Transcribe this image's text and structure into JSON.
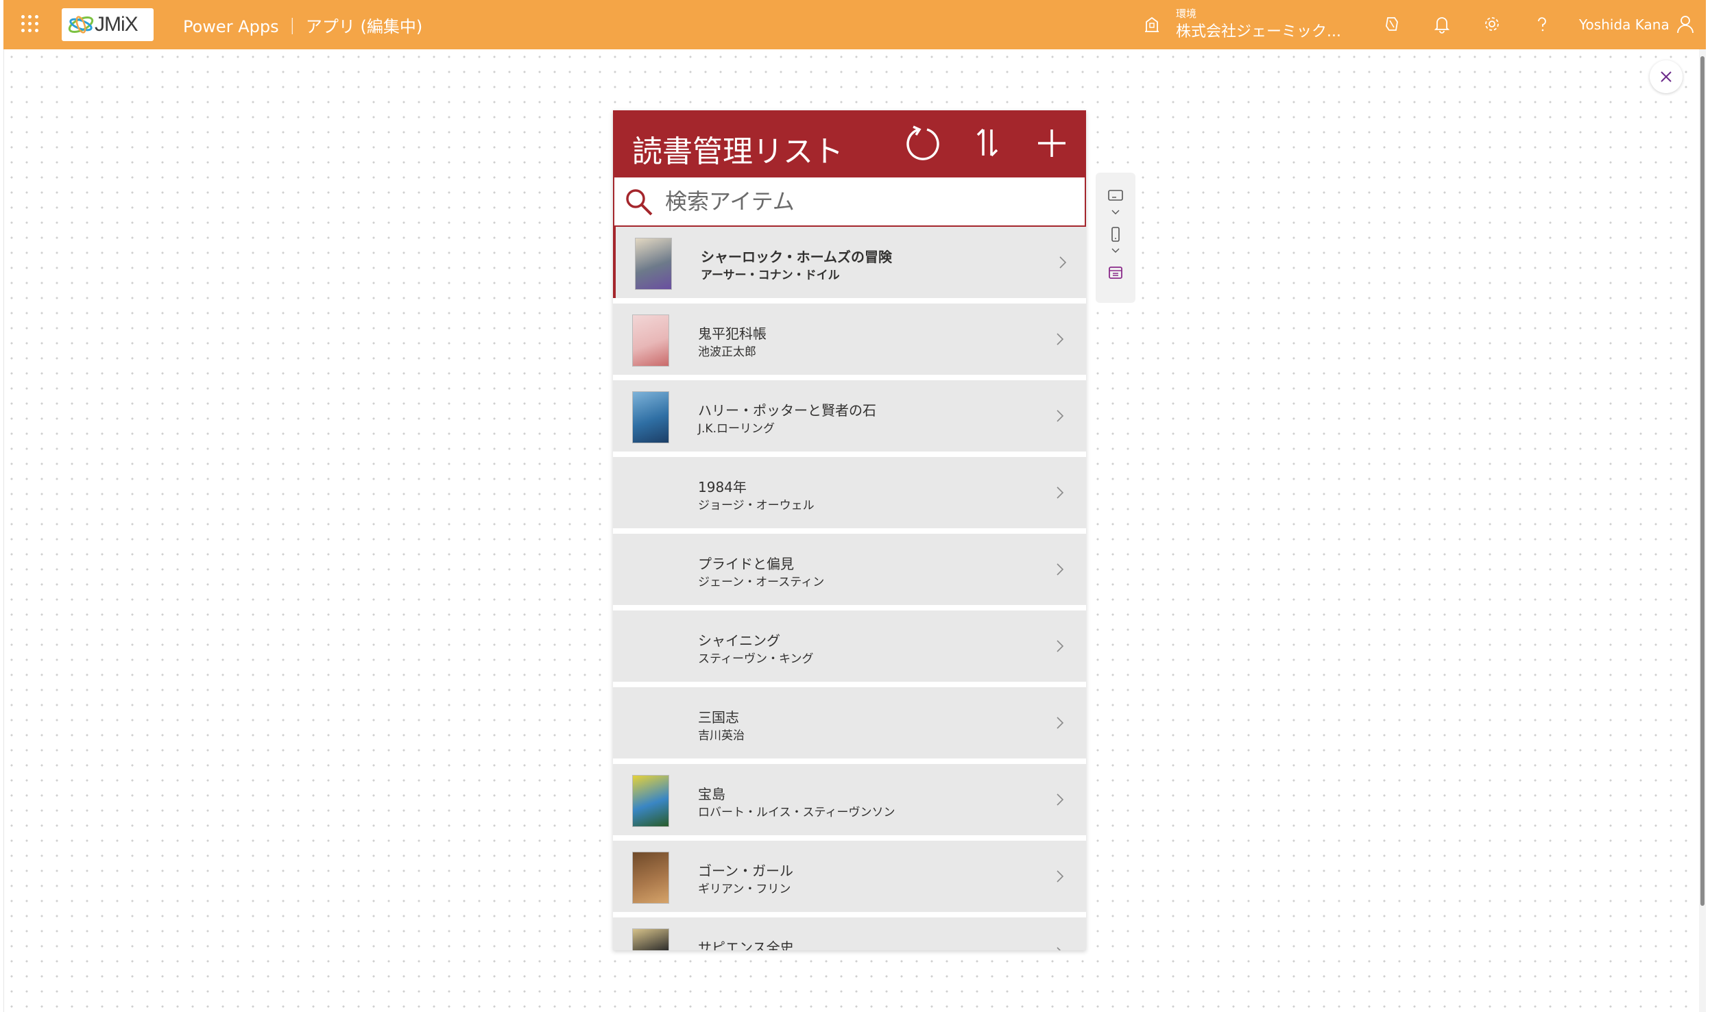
{
  "topbar": {
    "logo_text": "JMiX",
    "app_title": "Power Apps ｜ アプリ (編集中)",
    "env_label": "環境",
    "env_name": "株式会社ジェーミック...",
    "user_name": "Yoshida Kana",
    "bg_color": "#f4a547",
    "icons": [
      "waffle-icon",
      "environment-icon",
      "copilot-icon",
      "bell-icon",
      "gear-icon",
      "help-icon",
      "user-icon"
    ]
  },
  "app": {
    "header_title": "読書管理リスト",
    "header_color": "#a4262c",
    "actions": [
      "refresh-icon",
      "sort-icon",
      "add-icon"
    ],
    "search_placeholder": "検索アイテム",
    "items": [
      {
        "title": "シャーロック・ホームズの冒険",
        "author": "アーサー・コナン・ドイル",
        "has_image": true,
        "selected": true
      },
      {
        "title": "鬼平犯科帳",
        "author": "池波正太郎",
        "has_image": true,
        "selected": false
      },
      {
        "title": "ハリー・ポッターと賢者の石",
        "author": "J.K.ローリング",
        "has_image": true,
        "selected": false
      },
      {
        "title": "1984年",
        "author": "ジョージ・オーウェル",
        "has_image": false,
        "selected": false
      },
      {
        "title": "プライドと偏見",
        "author": "ジェーン・オースティン",
        "has_image": false,
        "selected": false
      },
      {
        "title": "シャイニング",
        "author": "スティーヴン・キング",
        "has_image": false,
        "selected": false
      },
      {
        "title": "三国志",
        "author": "吉川英治",
        "has_image": false,
        "selected": false
      },
      {
        "title": "宝島",
        "author": "ロバート・ルイス・スティーヴンソン",
        "has_image": true,
        "selected": false
      },
      {
        "title": "ゴーン・ガール",
        "author": "ギリアン・フリン",
        "has_image": true,
        "selected": false
      },
      {
        "title": "サピエンス全史",
        "author": "",
        "has_image": true,
        "selected": false
      }
    ]
  },
  "side_tools": [
    "comment-icon",
    "phone-icon",
    "table-icon"
  ]
}
